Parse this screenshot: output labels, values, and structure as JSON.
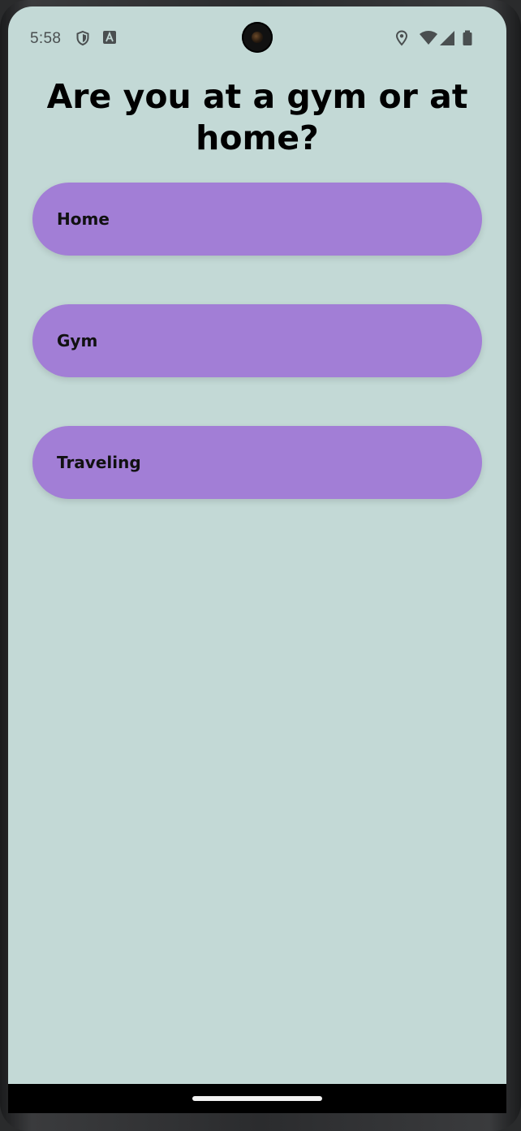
{
  "status_bar": {
    "time": "5:58",
    "left_icons": [
      "shield-icon",
      "a11y-font-icon"
    ],
    "right_icons": [
      "location-icon",
      "wifi-icon",
      "cell-signal-icon",
      "battery-icon"
    ]
  },
  "question": {
    "title": "Are you at a gym or at home?"
  },
  "options": [
    {
      "label": "Home"
    },
    {
      "label": "Gym"
    },
    {
      "label": "Traveling"
    }
  ],
  "colors": {
    "background": "#c3d9d6",
    "button": "#a27ed6",
    "text": "#000000"
  }
}
